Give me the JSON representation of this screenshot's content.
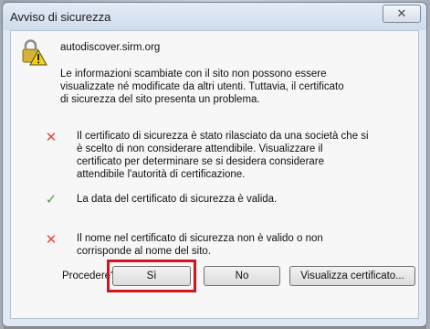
{
  "dialog": {
    "title": "Avviso di sicurezza",
    "site": "autodiscover.sirm.org",
    "info_lines": [
      "Le informazioni scambiate con il sito non possono essere",
      "visualizzate né modificate da altri utenti. Tuttavia, il certificato",
      "di sicurezza del sito presenta un problema."
    ],
    "checks": [
      {
        "status": "fail",
        "lines": [
          "Il certificato di sicurezza è stato rilasciato da una società che si",
          "è scelto di non considerare attendibile. Visualizzare il",
          "certificato per determinare se si desidera considerare",
          "attendibile l'autorità di certificazione."
        ]
      },
      {
        "status": "ok",
        "lines": [
          "La data del certificato di sicurezza è valida."
        ]
      },
      {
        "status": "fail",
        "lines": [
          "Il nome nel certificato di sicurezza non è valido o non",
          "corrisponde al nome del sito."
        ]
      }
    ],
    "prompt": "Procedere?",
    "buttons": {
      "yes": "Sì",
      "no": "No",
      "view_cert": "Visualizza certificato..."
    },
    "close_glyph": "✕"
  },
  "colors": {
    "fail": "#e24a3c",
    "ok": "#4aa34a",
    "highlight": "#d0161f"
  }
}
